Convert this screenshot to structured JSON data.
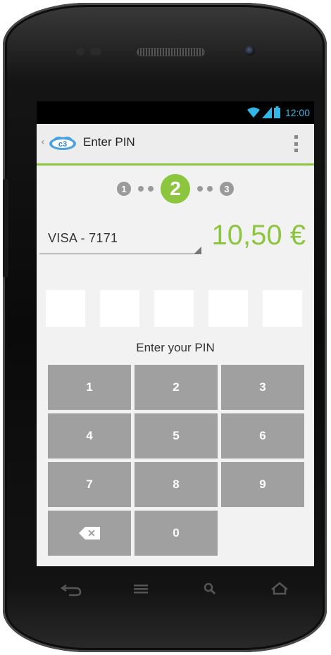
{
  "status_bar": {
    "time": "12:00",
    "icons": [
      "wifi-icon",
      "signal-icon",
      "battery-icon"
    ],
    "color": "#33b5e5"
  },
  "action_bar": {
    "title": "Enter PIN",
    "logo_icon": "cloud-logo-icon",
    "accent_color": "#8cc63f"
  },
  "steps": {
    "items": [
      "1",
      "2",
      "3"
    ],
    "current": "2"
  },
  "payment": {
    "card_label": "VISA  - 7171",
    "amount": "10,50 €"
  },
  "pin": {
    "boxes": 5,
    "prompt": "Enter your PIN"
  },
  "keypad": {
    "keys": [
      "1",
      "2",
      "3",
      "4",
      "5",
      "6",
      "7",
      "8",
      "9",
      "",
      "0",
      ""
    ],
    "backspace_icon": "backspace-icon",
    "backspace_glyph": "✕"
  },
  "nav_bar": {
    "icons": [
      "back-icon",
      "menu-icon",
      "search-icon",
      "home-icon"
    ]
  },
  "colors": {
    "accent": "#8cc63f",
    "key": "#a0a0a0",
    "step_inactive": "#9a9a9a"
  }
}
